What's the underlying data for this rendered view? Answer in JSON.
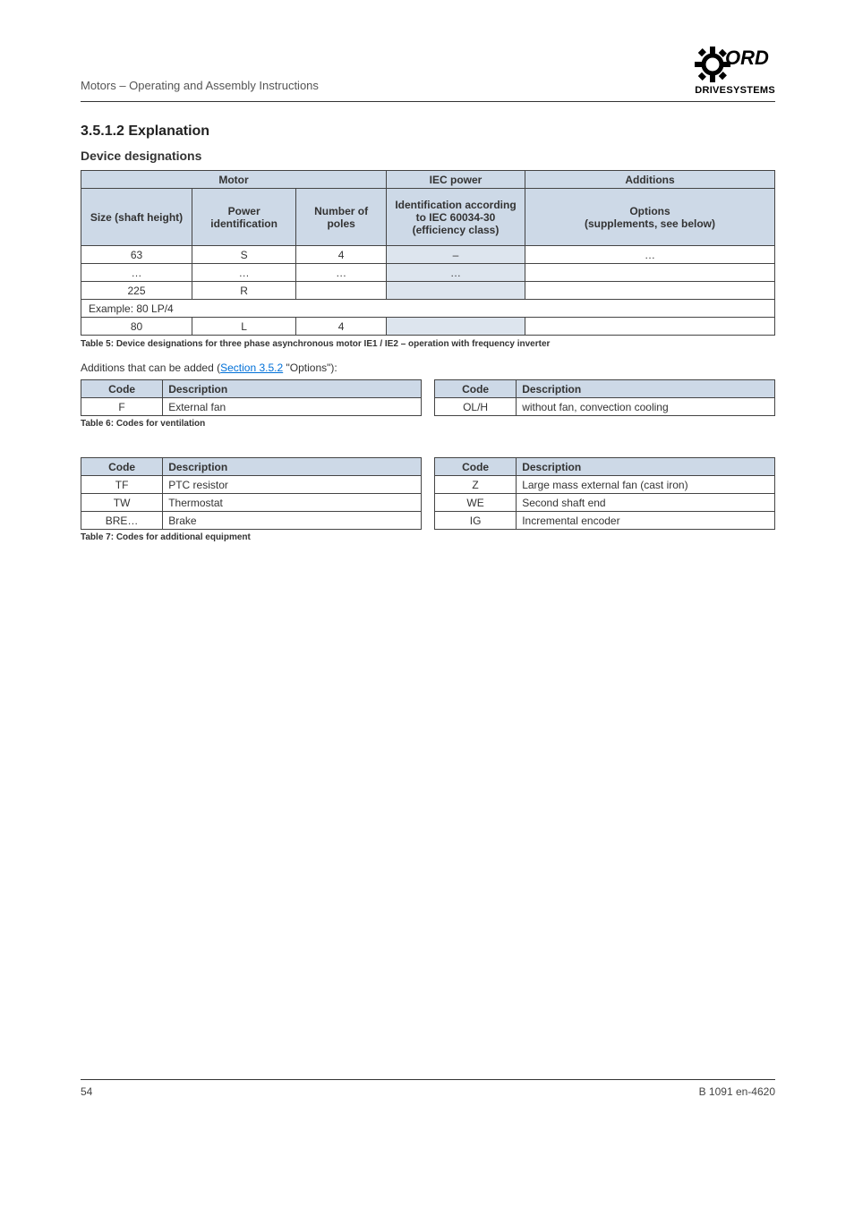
{
  "header": {
    "doc_title": "Motors – Operating and Assembly Instructions",
    "brand_sub": "DRIVESYSTEMS"
  },
  "sections": {
    "main_heading": "3.5.1.2 Explanation",
    "sub_heading": "Device designations",
    "caption1": "Table 5: Device designations for three phase asynchronous motor IE1 / IE2 – operation with frequency inverter",
    "intro2_prefix": "Additions that can be added (",
    "intro2_link": "Section 3.5.2",
    "intro2_suffix": " \"Options\"):",
    "caption2": "Table 6: Codes for ventilation",
    "caption3": "Table 7: Codes for additional equipment"
  },
  "table1": {
    "group1": "Motor",
    "group2": "IEC power",
    "group3": "Additions",
    "h_size": "Size (shaft height)",
    "h_power": "Power identification",
    "h_poles": "Number of poles",
    "h_iec": "Identification according to IEC 60034-30 (efficiency class)",
    "h_opt": "Options\n(supplements, see below)",
    "rows": [
      [
        "63",
        "S",
        "4",
        "–",
        "…"
      ],
      [
        "…",
        "…",
        "…",
        "…",
        ""
      ],
      [
        "225",
        "R",
        "",
        "",
        ""
      ]
    ],
    "mid_example": "Example: 80 LP/4",
    "bot_row": [
      "80",
      "L",
      "4",
      "",
      ""
    ]
  },
  "small_left1": {
    "h1": "Code",
    "h2": "Description",
    "r1c1": "F",
    "r1c2": "External fan"
  },
  "small_right1": {
    "h1": "Code",
    "h2": "Description",
    "r1c1": "OL/H",
    "r1c2": "without fan, convection cooling"
  },
  "small_left2": {
    "h1": "Code",
    "h2": "Description",
    "rows": [
      [
        "TF",
        "PTC resistor"
      ],
      [
        "TW",
        "Thermostat"
      ],
      [
        "BRE…",
        "Brake"
      ]
    ]
  },
  "small_right2": {
    "h1": "Code",
    "h2": "Description",
    "rows": [
      [
        "Z",
        "Large mass external fan (cast iron)"
      ],
      [
        "WE",
        "Second shaft end"
      ],
      [
        "IG",
        "Incremental encoder"
      ]
    ]
  },
  "footer": {
    "left": "54",
    "right": "B 1091 en-4620"
  }
}
